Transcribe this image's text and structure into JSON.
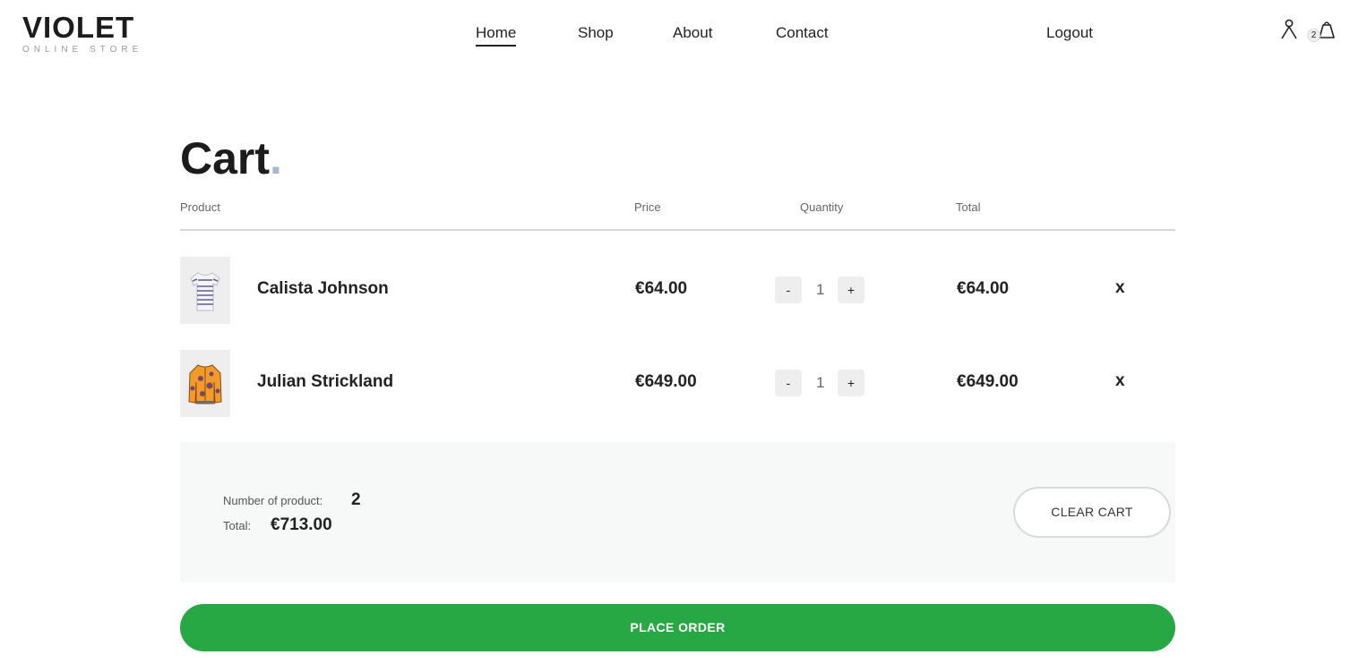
{
  "brand": {
    "name": "VIOLET",
    "tagline": "ONLINE STORE"
  },
  "nav": {
    "home": "Home",
    "shop": "Shop",
    "about": "About",
    "contact": "Contact",
    "logout": "Logout"
  },
  "header": {
    "cart_count": "2",
    "icons": [
      "user-icon",
      "shopping-bag-icon"
    ]
  },
  "cart": {
    "title": "Cart",
    "title_dot": ".",
    "columns": {
      "product": "Product",
      "price": "Price",
      "quantity": "Quantity",
      "total": "Total"
    },
    "items": [
      {
        "name": "Calista Johnson",
        "price": "€64.00",
        "minus": "-",
        "qty": "1",
        "plus": "+",
        "total": "€64.00",
        "remove": "x",
        "image": "striped-tshirt"
      },
      {
        "name": "Julian Strickland",
        "price": "€649.00",
        "minus": "-",
        "qty": "1",
        "plus": "+",
        "total": "€649.00",
        "remove": "x",
        "image": "orange-jacket"
      }
    ],
    "summary": {
      "count_label": "Number of product:",
      "count_value": "2",
      "total_label": "Total:",
      "total_value": "€713.00",
      "clear_label": "CLEAR CART"
    },
    "place_order_label": "PLACE ORDER"
  },
  "colors": {
    "accent_dot": "#a7b6c8",
    "order_button": "#28a745",
    "text": "#222222"
  }
}
